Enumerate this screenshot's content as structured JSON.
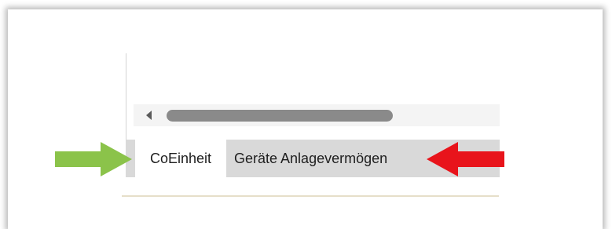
{
  "sheet_tabs": [
    {
      "label": "CoEinheit",
      "active": true
    },
    {
      "label": "Geräte Anlagevermögen",
      "active": false
    }
  ],
  "colors": {
    "green_arrow": "#8bc34a",
    "red_arrow": "#e8141b",
    "tab_bar": "#d9d9d9",
    "scroll_thumb": "#8a8a8a"
  },
  "icons": {
    "scroll_left": "scroll-left-arrow-icon",
    "annotation_right": "green-arrow-icon",
    "annotation_left": "red-arrow-icon"
  }
}
